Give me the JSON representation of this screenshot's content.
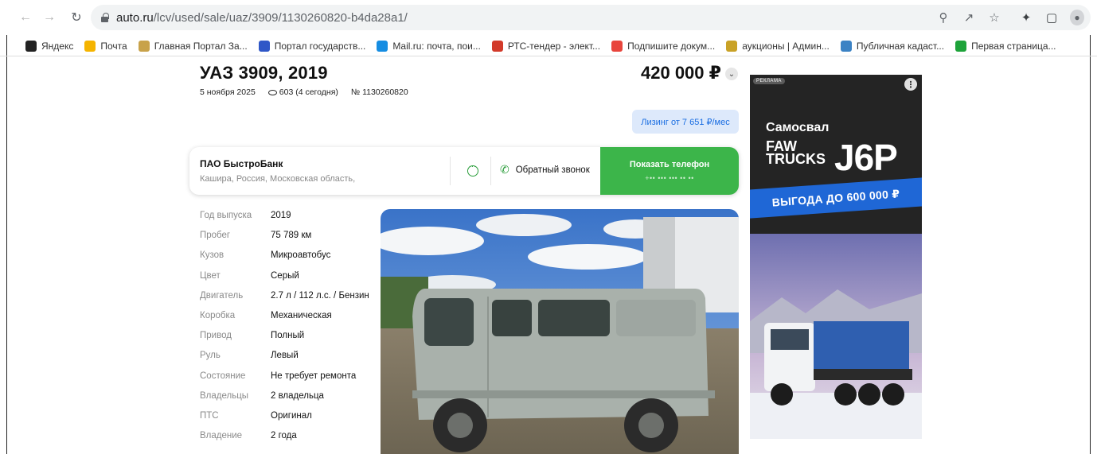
{
  "browser": {
    "url_host": "auto.ru",
    "url_path": "/lcv/used/sale/uaz/3909/1130260820-b4da28a1/"
  },
  "bookmarks": [
    {
      "label": "Яндекс",
      "color": "#222222"
    },
    {
      "label": "Почта",
      "color": "#f5b400"
    },
    {
      "label": "Главная Портал За...",
      "color": "#c8a24a"
    },
    {
      "label": "Портал государств...",
      "color": "#2f57c7"
    },
    {
      "label": "Mail.ru: почта, пои...",
      "color": "#168de2"
    },
    {
      "label": "РТС-тендер - элект...",
      "color": "#d23a2a"
    },
    {
      "label": "Подпишите докум...",
      "color": "#e8453c"
    },
    {
      "label": "аукционы | Админ...",
      "color": "#c9a227"
    },
    {
      "label": "Публичная кадаст...",
      "color": "#3b82c4"
    },
    {
      "label": "Первая страница...",
      "color": "#1ea33a"
    }
  ],
  "listing": {
    "title": "УАЗ 3909, 2019",
    "price": "420 000 ₽",
    "date": "5 ноября 2025",
    "views": "603 (4 сегодня)",
    "number": "№ 1130260820",
    "leasing": "Лизинг от 7 651 ₽/мес"
  },
  "seller": {
    "name": "ПАО БыстроБанк",
    "location": "Кашира, Россия, Московская область,",
    "callback_label": "Обратный звонок",
    "show_phone_label": "Показать телефон",
    "phone_mask": "+•• ••• ••• •• ••"
  },
  "specs": [
    {
      "key": "Год выпуска",
      "value": "2019"
    },
    {
      "key": "Пробег",
      "value": "75 789 км"
    },
    {
      "key": "Кузов",
      "value": "Микроавтобус"
    },
    {
      "key": "Цвет",
      "value": "Серый"
    },
    {
      "key": "Двигатель",
      "value": "2.7 л / 112 л.с. / Бензин"
    },
    {
      "key": "Коробка",
      "value": "Механическая"
    },
    {
      "key": "Привод",
      "value": "Полный"
    },
    {
      "key": "Руль",
      "value": "Левый"
    },
    {
      "key": "Состояние",
      "value": "Не требует ремонта"
    },
    {
      "key": "Владельцы",
      "value": "2 владельца"
    },
    {
      "key": "ПТС",
      "value": "Оригинал"
    },
    {
      "key": "Владение",
      "value": "2 года"
    }
  ],
  "ad": {
    "badge": "РЕКЛАМА",
    "headline": "Самосвал",
    "brand_line1": "FAW",
    "brand_line2": "TRUCKS",
    "model": "J6P",
    "promo": "ВЫГОДА ДО 600 000 ₽"
  },
  "colors": {
    "accent_green": "#3cb54a",
    "leasing_blue": "#1b6ee2",
    "ad_blue": "#1f67d6"
  }
}
